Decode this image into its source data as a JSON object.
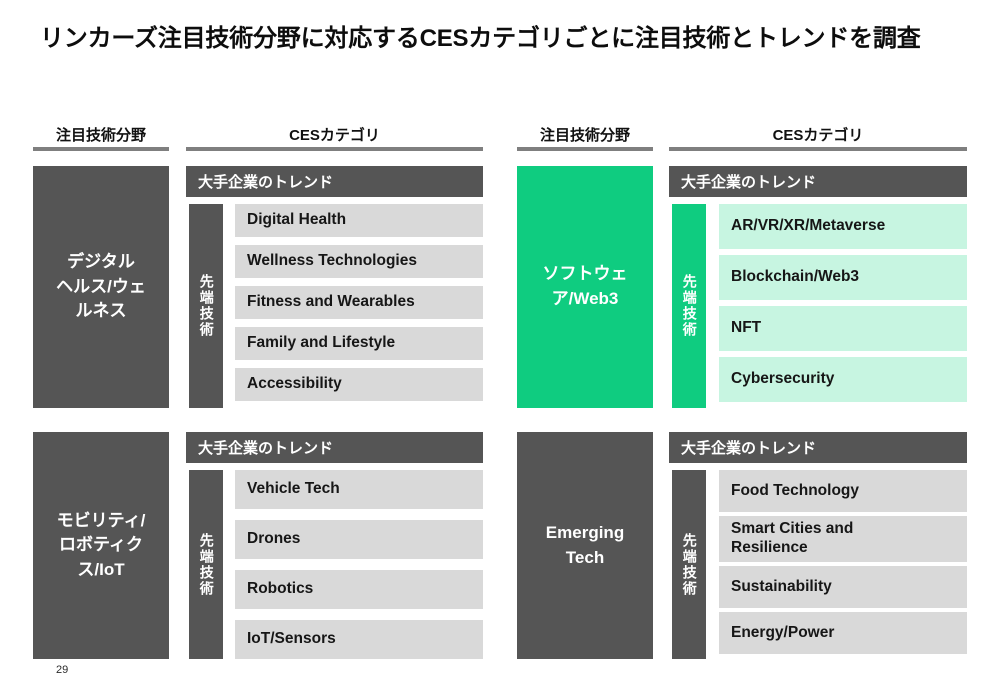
{
  "slide": {
    "title": "リンカーズ注目技術分野に対応するCESカテゴリごとに注目技術とトレンドを調査",
    "page_number": "29"
  },
  "colors": {
    "accent_green": "#0FCC80",
    "accent_green_light": "#C7F5E1",
    "dark_gray": "#555555",
    "light_gray": "#D9D9D9",
    "rule_gray": "#7F7F7F"
  },
  "column_headers": {
    "left_group": {
      "domain": "注目技術分野",
      "category": "CESカテゴリ"
    },
    "right_group": {
      "domain": "注目技術分野",
      "category": "CESカテゴリ"
    }
  },
  "labels": {
    "trend_bar": "大手企業のトレンド",
    "vertical_bar": "先端技術"
  },
  "quadrants": [
    {
      "id": "digital-health",
      "domain": "デジタル\nヘルス/ウェ\nルネス",
      "trend_label": "大手企業のトレンド",
      "vertical_label": "先端技術",
      "highlight": false,
      "items": [
        "Digital Health",
        "Wellness Technologies",
        "Fitness and Wearables",
        "Family and Lifestyle",
        "Accessibility"
      ]
    },
    {
      "id": "software-web3",
      "domain": "ソフトウェ\nア/Web3",
      "trend_label": "大手企業のトレンド",
      "vertical_label": "先端技術",
      "highlight": true,
      "items": [
        "AR/VR/XR/Metaverse",
        "Blockchain/Web3",
        "NFT",
        "Cybersecurity"
      ]
    },
    {
      "id": "mobility-robotics-iot",
      "domain": "モビリティ/\nロボティク\nス/IoT",
      "trend_label": "大手企業のトレンド",
      "vertical_label": "先端技術",
      "highlight": false,
      "items": [
        "Vehicle Tech",
        "Drones",
        "Robotics",
        "IoT/Sensors"
      ]
    },
    {
      "id": "emerging-tech",
      "domain": "Emerging\nTech",
      "trend_label": "大手企業のトレンド",
      "vertical_label": "先端技術",
      "highlight": false,
      "items": [
        "Food Technology",
        "Smart Cities and\nResilience",
        "Sustainability",
        "Energy/Power"
      ]
    }
  ]
}
